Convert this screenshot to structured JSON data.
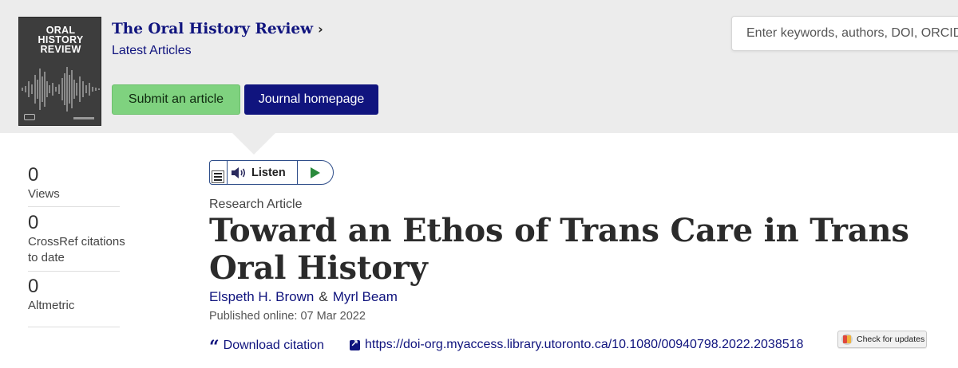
{
  "header": {
    "cover": {
      "title_lines": [
        "ORAL",
        "HISTORY",
        "REVIEW"
      ],
      "bg_color": "#3d3d3d"
    },
    "journal_title": "The Oral History Review",
    "journal_chevron": "›",
    "latest_articles": "Latest Articles",
    "submit_label": "Submit an article",
    "homepage_label": "Journal homepage",
    "search_placeholder": "Enter keywords, authors, DOI, ORCID or phrase",
    "colors": {
      "header_bg": "#ececec",
      "brand_blue": "#10147e",
      "submit_green": "#7fd27f"
    }
  },
  "metrics": [
    {
      "value": "0",
      "label": "Views"
    },
    {
      "value": "0",
      "label": "CrossRef citations to date"
    },
    {
      "value": "0",
      "label": "Altmetric"
    }
  ],
  "listen": {
    "label": "Listen"
  },
  "article": {
    "type": "Research Article",
    "title": "Toward an Ethos of Trans Care in Trans Oral History",
    "authors": [
      "Elspeth H. Brown",
      "Myrl Beam"
    ],
    "author_separator": "&",
    "published": "Published online: 07 Mar 2022",
    "download_citation": "Download citation",
    "doi_link": "https://doi-org.myaccess.library.utoronto.ca/10.1080/00940798.2022.2038518",
    "check_updates": "Check for updates"
  }
}
